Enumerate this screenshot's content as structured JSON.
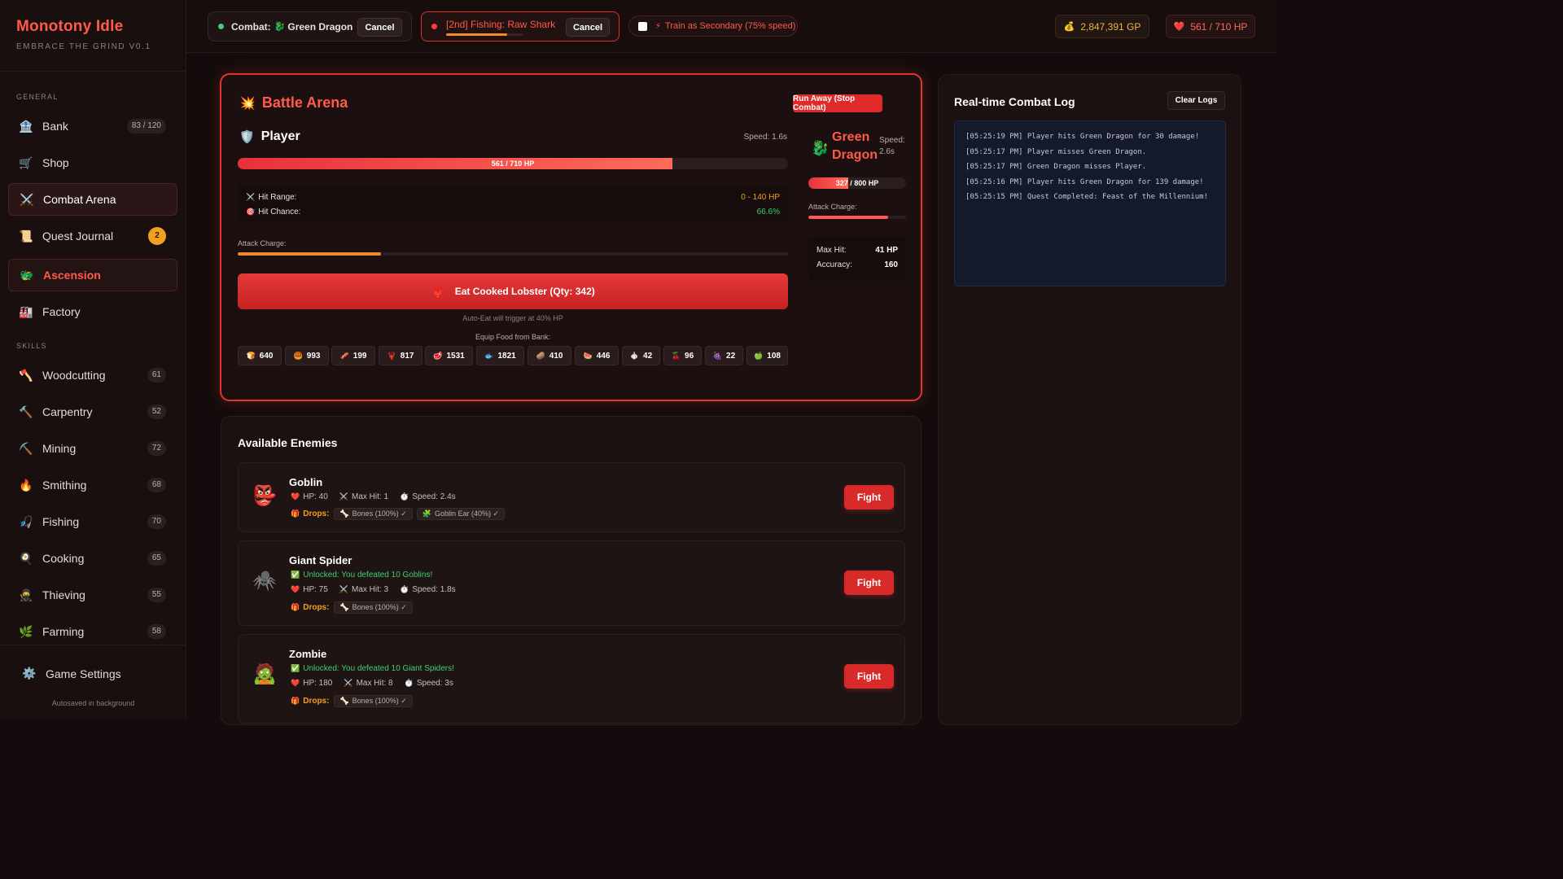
{
  "brand": {
    "title": "Monotony Idle",
    "subtitle": "EMBRACE THE GRIND V0.1"
  },
  "sidebar": {
    "general_label": "GENERAL",
    "skills_label": "SKILLS",
    "general": [
      {
        "label": "Bank",
        "icon": "🏦",
        "badge": "83 / 120"
      },
      {
        "label": "Shop",
        "icon": "🛒",
        "badge": ""
      },
      {
        "label": "Combat Arena",
        "icon": "⚔️",
        "badge": ""
      },
      {
        "label": "Quest Journal",
        "icon": "📜",
        "badge": "2"
      },
      {
        "label": "Ascension",
        "icon": "🐲",
        "badge": ""
      },
      {
        "label": "Factory",
        "icon": "🏭",
        "badge": ""
      }
    ],
    "skills": [
      {
        "label": "Woodcutting",
        "icon": "🪓",
        "badge": "61"
      },
      {
        "label": "Carpentry",
        "icon": "🔨",
        "badge": "52"
      },
      {
        "label": "Mining",
        "icon": "⛏️",
        "badge": "72"
      },
      {
        "label": "Smithing",
        "icon": "🔥",
        "badge": "68"
      },
      {
        "label": "Fishing",
        "icon": "🎣",
        "badge": "70"
      },
      {
        "label": "Cooking",
        "icon": "🍳",
        "badge": "65"
      },
      {
        "label": "Thieving",
        "icon": "🥷",
        "badge": "55"
      },
      {
        "label": "Farming",
        "icon": "🌿",
        "badge": "58"
      }
    ],
    "settings_label": "Game Settings",
    "autosave": "Autosaved in background"
  },
  "topbar": {
    "combat_prefix": "Combat:",
    "combat_target": "Green Dragon",
    "combat_icon": "🐉",
    "cancel_label": "Cancel",
    "fishing_label": "[2nd] Fishing: Raw Shark",
    "fishing_progress": 0.8,
    "train_label": "Train as Secondary (75% speed)",
    "train_icon": "⚡",
    "gold": "2,847,391 GP",
    "gold_icon": "💰",
    "hp": "561 / 710 HP",
    "hp_icon": "❤️"
  },
  "arena": {
    "title": "Battle Arena",
    "title_icon": "💥",
    "run_away_label": "Run Away (Stop Combat)",
    "player": {
      "name": "Player",
      "icon": "🛡️",
      "speed": "Speed: 1.6s",
      "hp_text": "561 / 710 HP",
      "hp_fraction": 0.79,
      "hit_range_label": "Hit Range:",
      "hit_range_value": "0 - 140 HP",
      "hit_chance_label": "Hit Chance:",
      "hit_chance_value": "66.6%",
      "attack_charge_label": "Attack Charge:",
      "attack_charge": 0.26
    },
    "enemy": {
      "name": "Green Dragon",
      "icon": "🐉",
      "speed": "Speed: 2.6s",
      "hp_text": "327 / 800 HP",
      "hp_fraction": 0.41,
      "attack_charge_label": "Attack Charge:",
      "attack_charge": 0.82,
      "max_hit_label": "Max Hit:",
      "max_hit_value": "41 HP",
      "accuracy_label": "Accuracy:",
      "accuracy_value": "160"
    },
    "eat_label": "Eat Cooked Lobster (Qty: 342)",
    "eat_icon": "🦞",
    "auto_eat_note": "Auto-Eat will trigger at 40% HP",
    "equip_label": "Equip Food from Bank:",
    "foods": [
      {
        "icon": "🍞",
        "qty": "640"
      },
      {
        "icon": "🥮",
        "qty": "993"
      },
      {
        "icon": "🥓",
        "qty": "199"
      },
      {
        "icon": "🦞",
        "qty": "817"
      },
      {
        "icon": "🥩",
        "qty": "1531"
      },
      {
        "icon": "🐟",
        "qty": "1821"
      },
      {
        "icon": "🥔",
        "qty": "410"
      },
      {
        "icon": "🍉",
        "qty": "446"
      },
      {
        "icon": "🧄",
        "qty": "42"
      },
      {
        "icon": "🍒",
        "qty": "96"
      },
      {
        "icon": "🍇",
        "qty": "22"
      },
      {
        "icon": "🍏",
        "qty": "108"
      }
    ]
  },
  "enemies": {
    "title": "Available Enemies",
    "fight_label": "Fight",
    "drops_label": "Drops:",
    "list": [
      {
        "name": "Goblin",
        "icon": "👺",
        "unlocked": "",
        "hp": "HP: 40",
        "max_hit": "Max Hit: 1",
        "speed": "Speed: 2.4s",
        "drops": [
          "Bones (100%) ✓",
          "Goblin Ear (40%) ✓"
        ]
      },
      {
        "name": "Giant Spider",
        "icon": "🕷️",
        "unlocked": "Unlocked: You defeated 10 Goblins!",
        "hp": "HP: 75",
        "max_hit": "Max Hit: 3",
        "speed": "Speed: 1.8s",
        "drops": [
          "Bones (100%) ✓"
        ]
      },
      {
        "name": "Zombie",
        "icon": "🧟",
        "unlocked": "Unlocked: You defeated 10 Giant Spiders!",
        "hp": "HP: 180",
        "max_hit": "Max Hit: 8",
        "speed": "Speed: 3s",
        "drops": [
          "Bones (100%) ✓"
        ]
      }
    ]
  },
  "log": {
    "title": "Real-time Combat Log",
    "clear_label": "Clear Logs",
    "lines": [
      "[05:25:19 PM] Player hits Green Dragon for 30 damage!",
      "[05:25:17 PM] Player misses Green Dragon.",
      "[05:25:17 PM] Green Dragon misses Player.",
      "[05:25:16 PM] Player hits Green Dragon for 139 damage!",
      "[05:25:15 PM] Quest Completed: Feast of the Millennium!"
    ]
  },
  "colors": {
    "accent": "#ff5a4a",
    "danger": "#e02a2a",
    "gold": "#f3b33d",
    "success": "#3ecf6e",
    "charge_player": "#f08a2a",
    "charge_enemy": "#ff5a5a"
  }
}
